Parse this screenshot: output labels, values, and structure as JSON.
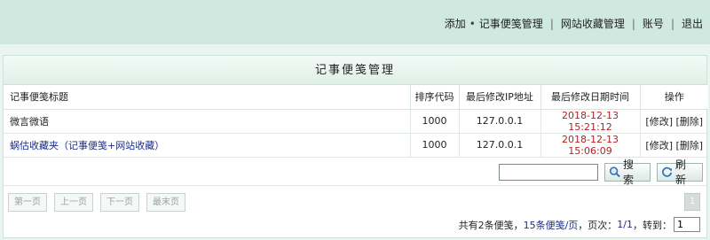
{
  "topnav": {
    "add": "添加",
    "notes": "记事便笺管理",
    "bookmarks": "网站收藏管理",
    "account": "账号",
    "logout": "退出"
  },
  "panel": {
    "title": "记事便笺管理"
  },
  "table": {
    "headers": [
      "记事便笺标题",
      "排序代码",
      "最后修改IP地址",
      "最后修改日期时间",
      "操作"
    ],
    "rows": [
      {
        "title": "微言微语",
        "order": "1000",
        "ip": "127.0.0.1",
        "datetime": "2018-12-13 15:21:12",
        "edit": "[修改]",
        "delete": "[删除]"
      },
      {
        "title": "蜗估收藏夹（记事便笺+网站收藏）",
        "order": "1000",
        "ip": "127.0.0.1",
        "datetime": "2018-12-13 15:06:09",
        "edit": "[修改]",
        "delete": "[删除]"
      }
    ]
  },
  "search": {
    "value": "",
    "search_label": "搜 索",
    "refresh_label": "刷 新"
  },
  "pager": {
    "first": "第一页",
    "prev": "上一页",
    "next": "下一页",
    "last": "最末页",
    "current_page_button": "1",
    "summary_prefix": "共有2条便笺，",
    "summary_per_page": "15条便笺/页",
    "summary_page_label": "，页次：",
    "summary_page": "1/1",
    "summary_goto": "，转到：",
    "jump_value": "1"
  }
}
